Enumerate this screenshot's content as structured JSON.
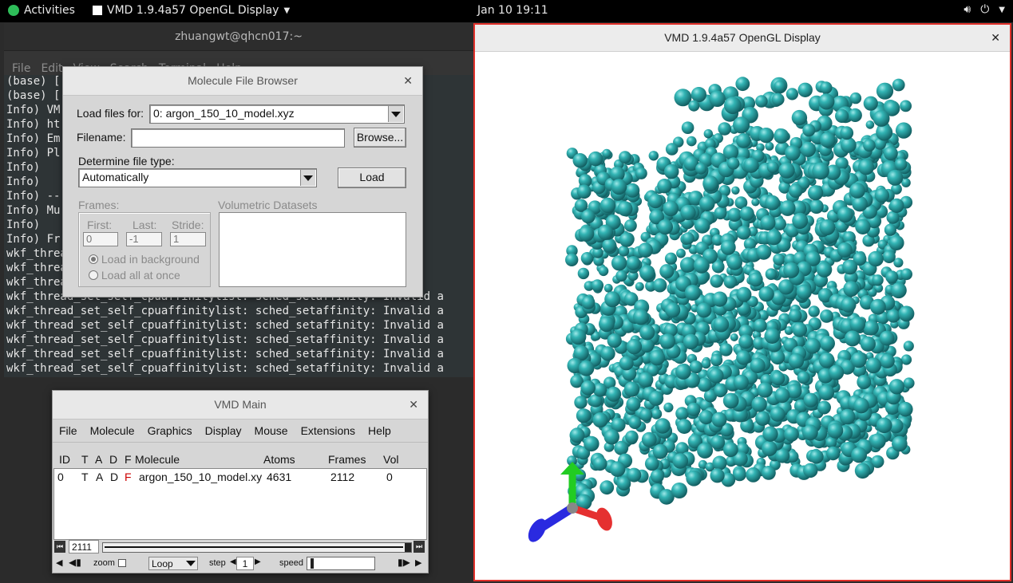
{
  "topbar": {
    "activities": "Activities",
    "app_name": "VMD 1.9.4a57 OpenGL Display",
    "clock": "Jan 10  19:11"
  },
  "terminal": {
    "title": "zhuangwt@qhcn017:~",
    "menu": [
      "File",
      "Edit",
      "View",
      "Search",
      "Terminal",
      "Help"
    ],
    "lines": [
      "(base) [",
      "(base) [",
      "Info) VM                                             )",
      "Info) ht",
      "Info) Em",
      "Info) Pl                                            g VMD:",
      "Info)                                               Visual",
      "Info)                                               1, 33-3",
      "Info) --                                            -------",
      "Info) Mu",
      "Info)                                               F AVX512",
      "Info) Fr",
      "wkf_threa                                           Invalid a",
      "wkf_threa                                           Invalid a",
      "wkf_threa                                           Invalid a",
      "wkf_thread_set_self_cpuaffinitylist: sched_setaffinity: Invalid a",
      "wkf_thread_set_self_cpuaffinitylist: sched_setaffinity: Invalid a",
      "wkf_thread_set_self_cpuaffinitylist: sched_setaffinity: Invalid a",
      "wkf_thread_set_self_cpuaffinitylist: sched_setaffinity: Invalid a",
      "wkf_thread_set_self_cpuaffinitylist: sched_setaffinity: Invalid a",
      "wkf_thread_set_self_cpuaffinitylist: sched_setaffinity: Invalid a"
    ]
  },
  "file_browser": {
    "title": "Molecule File Browser",
    "load_for_label": "Load files for:",
    "load_for_value": "0: argon_150_10_model.xyz",
    "filename_label": "Filename:",
    "filename_value": "",
    "browse_label": "Browse...",
    "filetype_label": "Determine file type:",
    "filetype_value": "Automatically",
    "load_label": "Load",
    "frames_label": "Frames:",
    "first_label": "First:",
    "first_value": "0",
    "last_label": "Last:",
    "last_value": "-1",
    "stride_label": "Stride:",
    "stride_value": "1",
    "bg_label": "Load in background",
    "all_label": "Load all at once",
    "volumetric_label": "Volumetric Datasets"
  },
  "vmd_main": {
    "title": "VMD Main",
    "menu": [
      "File",
      "Molecule",
      "Graphics",
      "Display",
      "Mouse",
      "Extensions",
      "Help"
    ],
    "headers": {
      "id": "ID",
      "t": "T",
      "a": "A",
      "d": "D",
      "f": "F",
      "molecule": "Molecule",
      "atoms": "Atoms",
      "frames": "Frames",
      "vol": "Vol"
    },
    "rows": [
      {
        "id": "0",
        "t": "T",
        "a": "A",
        "d": "D",
        "f": "F",
        "molecule": "argon_150_10_model.xyz",
        "atoms": "4631",
        "frames": "2112",
        "vol": "0"
      }
    ],
    "frame_value": "2111",
    "zoom_label": "zoom",
    "loop_value": "Loop",
    "step_label": "step",
    "step_value": "1",
    "speed_label": "speed"
  },
  "gl_display": {
    "title": "VMD 1.9.4a57 OpenGL Display",
    "atom_color": "#2aa0a0",
    "axes_colors": {
      "x": "#e53030",
      "y": "#22cc22",
      "z": "#2a2ae0"
    }
  },
  "colors": {
    "flag_red": "#cc0000",
    "accent_border": "#e0302a"
  }
}
